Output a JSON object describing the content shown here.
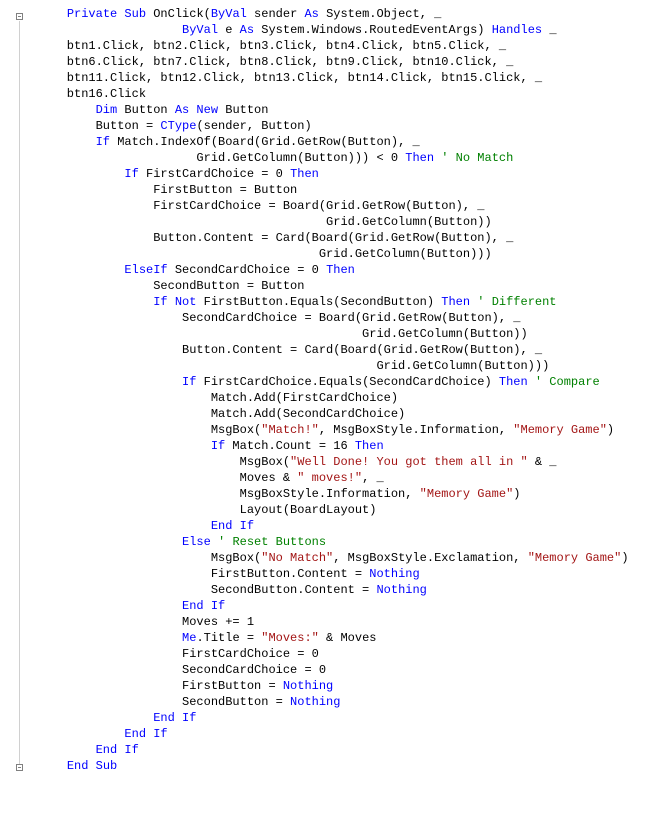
{
  "lines": {
    "l01a": "    ",
    "l01b": "Private Sub",
    "l01c": " OnClick(",
    "l01d": "ByVal",
    "l01e": " sender ",
    "l01f": "As",
    "l01g": " System.Object, _",
    "l02a": "                    ",
    "l02b": "ByVal",
    "l02c": " e ",
    "l02d": "As",
    "l02e": " System.Windows.RoutedEventArgs) ",
    "l02f": "Handles",
    "l02g": " _",
    "l03": "    btn1.Click, btn2.Click, btn3.Click, btn4.Click, btn5.Click, _",
    "l04": "    btn6.Click, btn7.Click, btn8.Click, btn9.Click, btn10.Click, _",
    "l05": "    btn11.Click, btn12.Click, btn13.Click, btn14.Click, btn15.Click, _",
    "l06": "    btn16.Click",
    "l07a": "        ",
    "l07b": "Dim",
    "l07c": " Button ",
    "l07d": "As New",
    "l07e": " Button",
    "l08a": "        Button = ",
    "l08b": "CType",
    "l08c": "(sender, Button)",
    "l09a": "        ",
    "l09b": "If",
    "l09c": " Match.IndexOf(Board(Grid.GetRow(Button), _",
    "l10a": "                      Grid.GetColumn(Button))) < 0 ",
    "l10b": "Then ",
    "l10c": "' No Match",
    "l11a": "            ",
    "l11b": "If",
    "l11c": " FirstCardChoice = 0 ",
    "l11d": "Then",
    "l12": "                FirstButton = Button",
    "l13": "                FirstCardChoice = Board(Grid.GetRow(Button), _",
    "l14": "                                        Grid.GetColumn(Button))",
    "l15": "                Button.Content = Card(Board(Grid.GetRow(Button), _",
    "l16": "                                       Grid.GetColumn(Button)))",
    "l17a": "            ",
    "l17b": "ElseIf",
    "l17c": " SecondCardChoice = 0 ",
    "l17d": "Then",
    "l18": "                SecondButton = Button",
    "l19a": "                ",
    "l19b": "If Not",
    "l19c": " FirstButton.Equals(SecondButton) ",
    "l19d": "Then ",
    "l19e": "' Different",
    "l20": "                    SecondCardChoice = Board(Grid.GetRow(Button), _",
    "l21": "                                             Grid.GetColumn(Button))",
    "l22": "                    Button.Content = Card(Board(Grid.GetRow(Button), _",
    "l23": "                                               Grid.GetColumn(Button)))",
    "l24a": "                    ",
    "l24b": "If",
    "l24c": " FirstCardChoice.Equals(SecondCardChoice) ",
    "l24d": "Then ",
    "l24e": "' Compare",
    "l25": "                        Match.Add(FirstCardChoice)",
    "l26": "                        Match.Add(SecondCardChoice)",
    "l27a": "                        MsgBox(",
    "l27b": "\"Match!\"",
    "l27c": ", MsgBoxStyle.Information, ",
    "l27d": "\"Memory Game\"",
    "l27e": ")",
    "l28a": "                        ",
    "l28b": "If",
    "l28c": " Match.Count = 16 ",
    "l28d": "Then",
    "l29a": "                            MsgBox(",
    "l29b": "\"Well Done! You got them all in \"",
    "l29c": " & _",
    "l30a": "                            Moves & ",
    "l30b": "\" moves!\"",
    "l30c": ", _",
    "l31a": "                            MsgBoxStyle.Information, ",
    "l31b": "\"Memory Game\"",
    "l31c": ")",
    "l32": "                            Layout(BoardLayout)",
    "l33a": "                        ",
    "l33b": "End If",
    "l34a": "                    ",
    "l34b": "Else ",
    "l34c": "' Reset Buttons",
    "l35a": "                        MsgBox(",
    "l35b": "\"No Match\"",
    "l35c": ", MsgBoxStyle.Exclamation, ",
    "l35d": "\"Memory Game\"",
    "l35e": ")",
    "l36a": "                        FirstButton.Content = ",
    "l36b": "Nothing",
    "l37a": "                        SecondButton.Content = ",
    "l37b": "Nothing",
    "l38a": "                    ",
    "l38b": "End If",
    "l39": "                    Moves += 1",
    "l40a": "                    ",
    "l40b": "Me",
    "l40c": ".Title = ",
    "l40d": "\"Moves:\"",
    "l40e": " & Moves",
    "l41": "                    FirstCardChoice = 0",
    "l42": "                    SecondCardChoice = 0",
    "l43a": "                    FirstButton = ",
    "l43b": "Nothing",
    "l44a": "                    SecondButton = ",
    "l44b": "Nothing",
    "l45a": "                ",
    "l45b": "End If",
    "l46a": "            ",
    "l46b": "End If",
    "l47a": "        ",
    "l47b": "End If",
    "l48a": "    ",
    "l48b": "End Sub"
  }
}
